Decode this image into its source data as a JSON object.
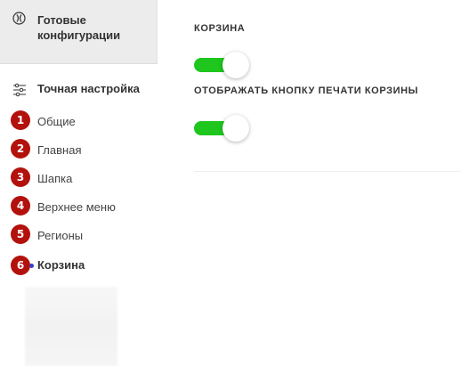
{
  "sidebar": {
    "ready_configs": {
      "label": "Готовые конфигурации",
      "icon": "ready-config-icon"
    },
    "fine_tuning": {
      "label": "Точная настройка",
      "icon": "sliders-icon"
    },
    "items": [
      {
        "number": "1",
        "label": "Общие",
        "active": false
      },
      {
        "number": "2",
        "label": "Главная",
        "active": false
      },
      {
        "number": "3",
        "label": "Шапка",
        "active": false
      },
      {
        "number": "4",
        "label": "Верхнее меню",
        "active": false
      },
      {
        "number": "5",
        "label": "Регионы",
        "active": false
      },
      {
        "number": "6",
        "label": "Корзина",
        "active": true
      }
    ],
    "badge_color": "#b3110c",
    "active_dot_color": "#3b3fc9"
  },
  "main": {
    "settings": [
      {
        "title": "КОРЗИНА",
        "enabled": true
      },
      {
        "title": "ОТОБРАЖАТЬ КНОПКУ ПЕЧАТИ КОРЗИНЫ",
        "enabled": true
      }
    ],
    "toggle_on_color": "#1ec61e"
  }
}
